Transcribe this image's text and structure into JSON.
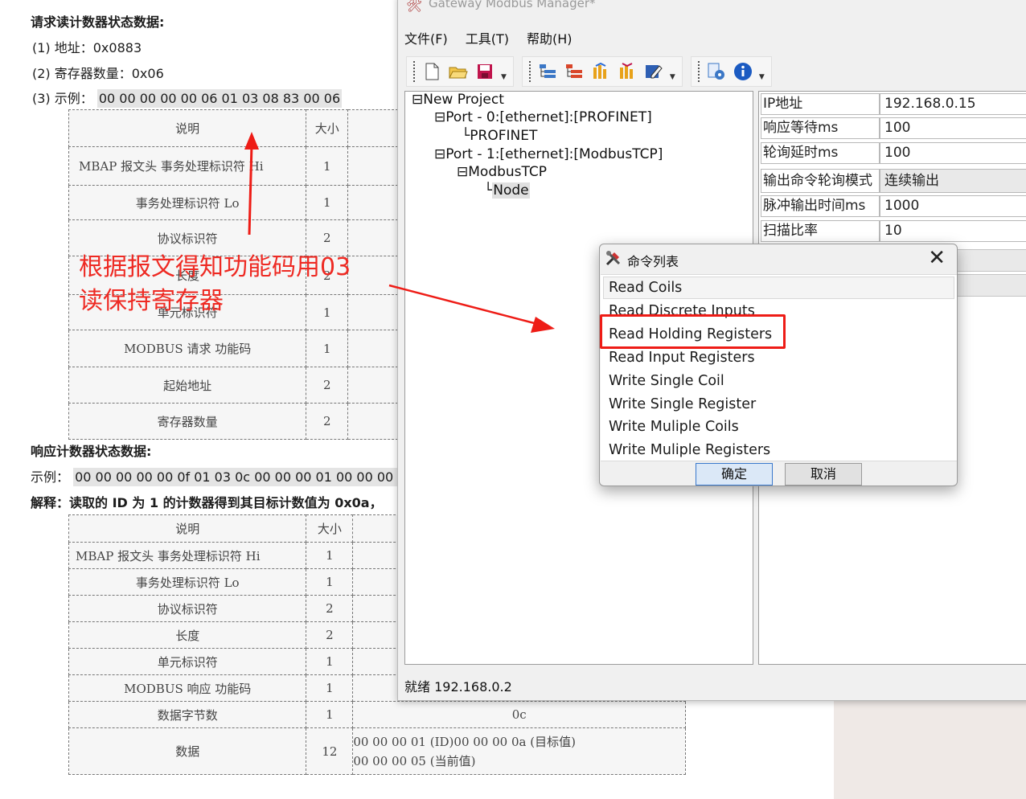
{
  "document": {
    "heading_request": "请求读计数器状态数据:",
    "req_line1": "(1)  地址：0x0883",
    "req_line2": "(2)  寄存器数量：0x06",
    "req_line3_label": "(3)  示例：",
    "req_line3_value": "00 00 00 00 00 06 01 03 08 83 00 06",
    "table1": {
      "headers": [
        "说明",
        "大小"
      ],
      "rows": [
        [
          "MBAP 报文头 事务处理标识符 Hi",
          "1"
        ],
        [
          "事务处理标识符 Lo",
          "1"
        ],
        [
          "协议标识符",
          "2"
        ],
        [
          "长度",
          "2"
        ],
        [
          "单元标识符",
          "1"
        ],
        [
          "MODBUS 请求 功能码",
          "1"
        ],
        [
          "起始地址",
          "2"
        ],
        [
          "寄存器数量",
          "2"
        ]
      ]
    },
    "heading_response": "响应计数器状态数据:",
    "resp_example_label": "示例：",
    "resp_example_value": "00 00 00 00 00 0f 01 03 0c 00 00 00 01 00 00 00 0",
    "resp_explain": "解释：读取的 ID 为 1 的计数器得到其目标计数值为 0x0a，",
    "table2": {
      "headers": [
        "说明",
        "大小"
      ],
      "rows": [
        [
          "MBAP 报文头 事务处理标识符 Hi",
          "1",
          ""
        ],
        [
          "事务处理标识符 Lo",
          "1",
          ""
        ],
        [
          "协议标识符",
          "2",
          ""
        ],
        [
          "长度",
          "2",
          ""
        ],
        [
          "单元标识符",
          "1",
          ""
        ],
        [
          "MODBUS 响应 功能码",
          "1",
          ""
        ],
        [
          "数据字节数",
          "1",
          "0c"
        ],
        [
          "数据",
          "12",
          "00 00 00 01 (ID)00 00 00 0a (目标值)\n00 00 00 05 (当前值)"
        ]
      ]
    },
    "annotation": "根据报文得知功能码用03\n读保持寄存器"
  },
  "window": {
    "title": "Gateway Modbus Manager*",
    "menu": [
      "文件(F)",
      "工具(T)",
      "帮助(H)"
    ],
    "tree": [
      {
        "prefix": "⊟",
        "label": "New Project"
      },
      {
        "prefix": "⊟",
        "label": "Port - 0:[ethernet]:[PROFINET]"
      },
      {
        "prefix": "└",
        "label": "PROFINET"
      },
      {
        "prefix": "⊟",
        "label": "Port - 1:[ethernet]:[ModbusTCP]"
      },
      {
        "prefix": "⊟",
        "label": "ModbusTCP"
      },
      {
        "prefix": "└",
        "label": "Node"
      }
    ],
    "properties": [
      {
        "key": "IP地址",
        "value": "192.168.0.15"
      },
      {
        "key": "响应等待ms",
        "value": "100"
      },
      {
        "key": "轮询延时ms",
        "value": "100"
      },
      {
        "key": "输出命令轮询模式",
        "value": "连续输出"
      },
      {
        "key": "脉冲输出时间ms",
        "value": "1000"
      },
      {
        "key": "扫描比率",
        "value": "10"
      }
    ],
    "status": "就绪  192.168.0.2"
  },
  "dialog": {
    "title": "命令列表",
    "items": [
      "Read Coils",
      "Read Discrete Inputs",
      "Read Holding Registers",
      "Read Input Registers",
      "Write Single Coil",
      "Write Single Register",
      "Write Muliple Coils",
      "Write Muliple Registers"
    ],
    "ok": "确定",
    "cancel": "取消"
  },
  "colors": {
    "annotation_red": "#ee2a23",
    "highlight_red": "#ee1c16",
    "ok_blue": "#3a78cc"
  }
}
